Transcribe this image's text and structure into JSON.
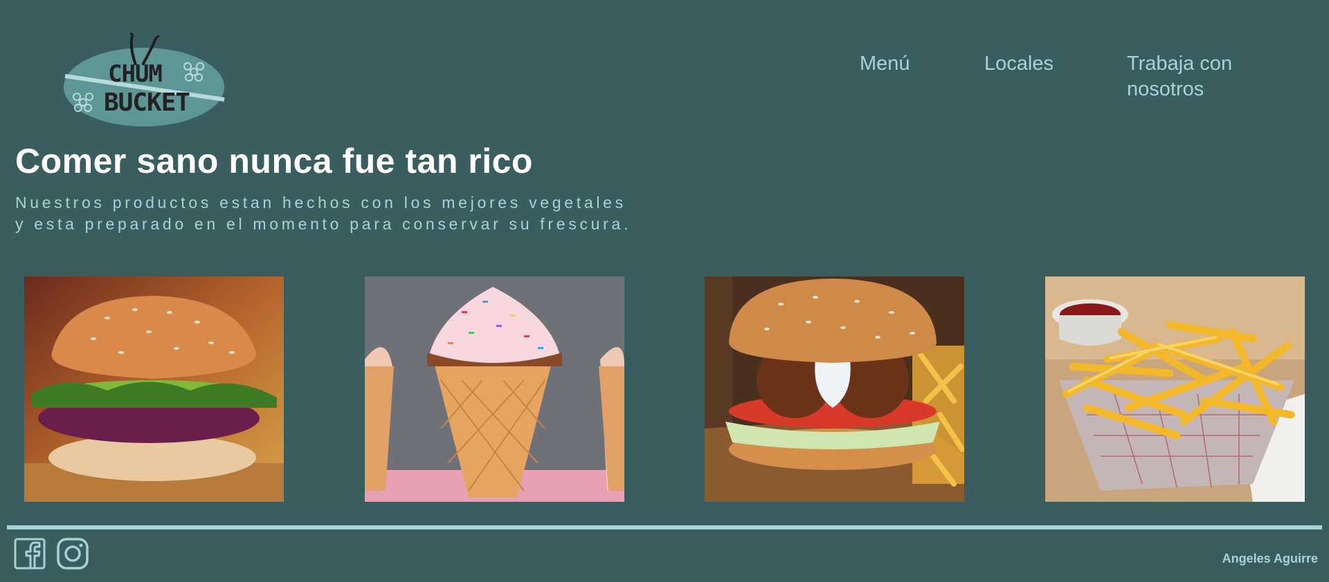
{
  "header": {
    "logo": {
      "line1": "CHUM",
      "line2": "BUCKET"
    },
    "nav": [
      {
        "label": "Menú"
      },
      {
        "label": "Locales"
      },
      {
        "label": "Trabaja con nosotros"
      }
    ]
  },
  "hero": {
    "headline": "Comer sano nunca fue tan rico",
    "subtitle_line1": "Nuestros productos estan hechos con los mejores vegetales",
    "subtitle_line2": "y esta preparado en el momento para conservar su frescura."
  },
  "gallery": [
    {
      "subject": "veggie burger"
    },
    {
      "subject": "ice cream cone"
    },
    {
      "subject": "falafel burger with fries"
    },
    {
      "subject": "french fries with ketchup"
    }
  ],
  "footer": {
    "social_icons": [
      "facebook-icon",
      "instagram-icon"
    ],
    "credit": "Angeles Aguirre"
  },
  "colors": {
    "background": "#3a5e60",
    "accent": "#a6d4d6",
    "headline": "#ffffff"
  }
}
